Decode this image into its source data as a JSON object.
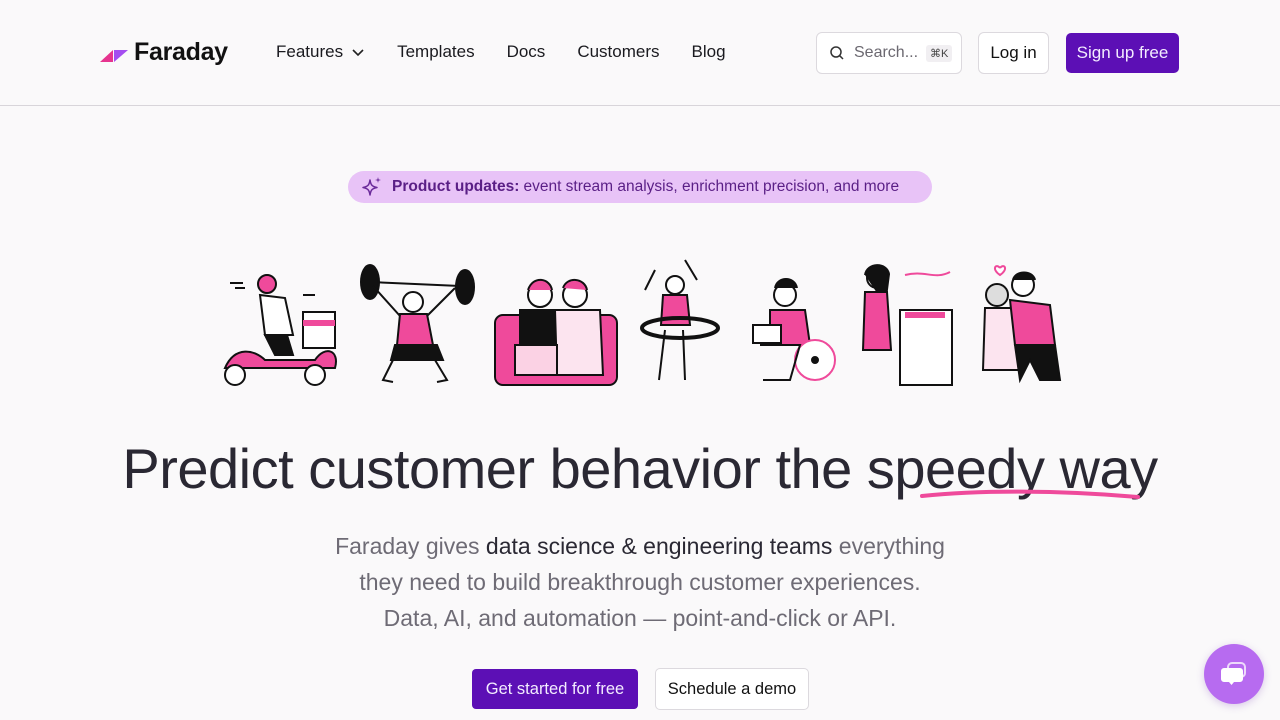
{
  "header": {
    "brand": "Faraday",
    "nav": [
      {
        "label": "Features",
        "has_dropdown": true
      },
      {
        "label": "Templates"
      },
      {
        "label": "Docs"
      },
      {
        "label": "Customers"
      },
      {
        "label": "Blog"
      }
    ],
    "search": {
      "placeholder": "Search...",
      "shortcut": "⌘K",
      "icon": "search-icon"
    },
    "login_label": "Log in",
    "signup_label": "Sign up free"
  },
  "announcement": {
    "icon": "sparkle-icon",
    "strong": "Product updates:",
    "text": "event stream analysis, enrichment precision, and more"
  },
  "illustrations": [
    "delivery-scooter-rider",
    "weightlifter-squat",
    "couple-on-sofa",
    "hula-hoop-dancer",
    "man-in-wheelchair-with-laptop",
    "woman-at-photocopier",
    "elderly-couple-dancing"
  ],
  "hero": {
    "headline_main": "Predict customer behavior the ",
    "headline_highlight": "speedy way",
    "sub_line1_pre": "Faraday gives ",
    "sub_line1_bold": "data science & engineering teams",
    "sub_line1_post": " everything",
    "sub_line2": "they need to build breakthrough customer experiences.",
    "sub_line3": "Data, AI, and automation — point-and-click or API.",
    "cta_primary": "Get started for free",
    "cta_secondary": "Schedule a demo"
  },
  "colors": {
    "accent": "#5c0fb5",
    "pill_bg": "#e8c3f7",
    "highlight_pink": "#ef4a9b",
    "chat_bubble": "#b76bf0"
  },
  "chat_widget": {
    "icon": "chat-bubble-icon"
  }
}
